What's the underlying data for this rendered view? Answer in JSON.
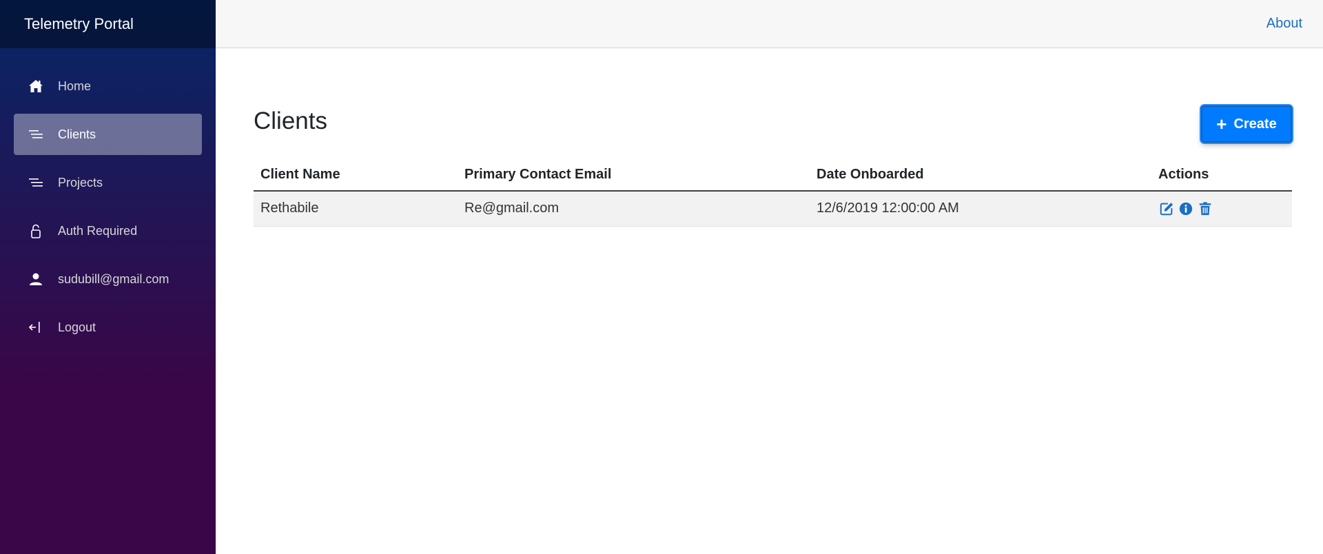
{
  "app": {
    "brand": "Telemetry Portal"
  },
  "top_nav": {
    "about_label": "About"
  },
  "sidebar": {
    "items": [
      {
        "label": "Home",
        "icon": "home-icon",
        "active": false
      },
      {
        "label": "Clients",
        "icon": "list-icon",
        "active": true
      },
      {
        "label": "Projects",
        "icon": "list-icon",
        "active": false
      },
      {
        "label": "Auth Required",
        "icon": "lock-icon",
        "active": false
      },
      {
        "label": "sudubill@gmail.com",
        "icon": "person-icon",
        "active": false
      },
      {
        "label": "Logout",
        "icon": "logout-icon",
        "active": false
      }
    ]
  },
  "page": {
    "title": "Clients",
    "create_label": "Create"
  },
  "table": {
    "headers": [
      "Client Name",
      "Primary Contact Email",
      "Date Onboarded",
      "Actions"
    ],
    "rows": [
      {
        "client_name": "Rethabile",
        "email": "Re@gmail.com",
        "date_onboarded": "12/6/2019 12:00:00 AM",
        "actions": [
          "edit-icon",
          "info-icon",
          "trash-icon"
        ]
      }
    ]
  },
  "colors": {
    "sidebar_top": "#052767",
    "sidebar_bottom": "#3a0647",
    "primary": "#007bff",
    "link": "#1b6ec2",
    "action_icon": "#1b6ec2"
  }
}
